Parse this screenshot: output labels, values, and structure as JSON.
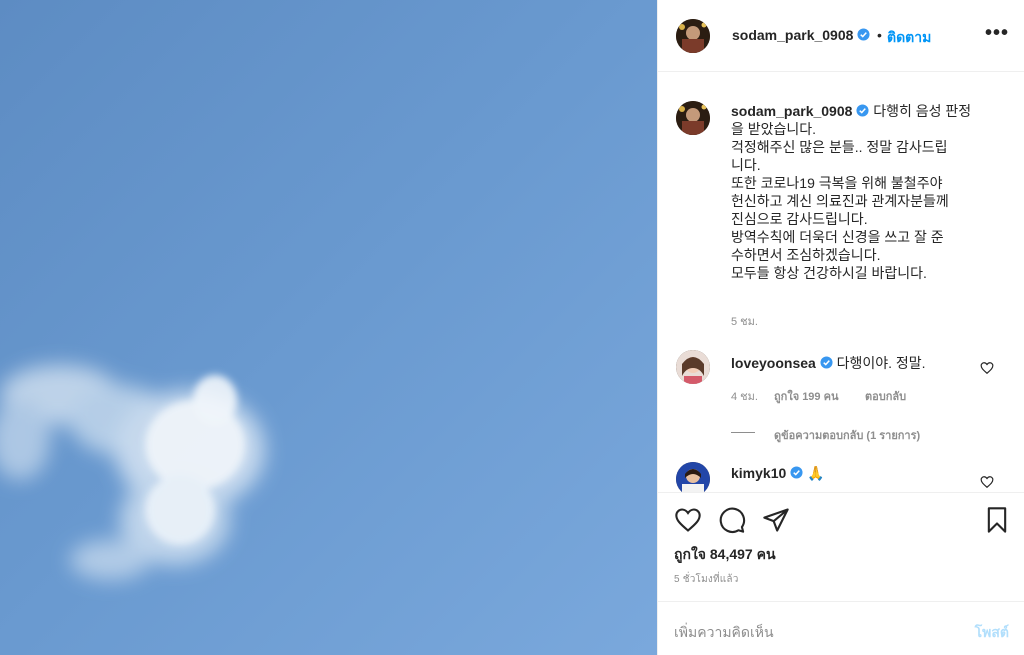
{
  "post": {
    "author": "sodam_park_0908",
    "follow_label": "ติดตาม",
    "separator": "•",
    "caption_lines": [
      "다행히 음성 판정",
      "을 받았습니다.",
      "걱정해주신 많은 분들.. 정말 감사드립",
      "니다.",
      "또한 코로나19 극복을 위해 불철주야",
      "헌신하고 계신 의료진과 관계자분들께",
      "진심으로 감사드립니다.",
      "방역수칙에 더욱더 신경을 쓰고 잘 준",
      "수하면서 조심하겠습니다.",
      "모두들 항상 건강하시길 바랍니다."
    ],
    "caption_time": "5 ชม.",
    "likes": "ถูกใจ 84,497 คน",
    "posted_time": "5 ชั่วโมงที่แล้ว",
    "comment_placeholder": "เพิ่มความคิดเห็น",
    "post_button": "โพสต์"
  },
  "comments": [
    {
      "username": "loveyoonsea",
      "text": "다행이야. 정말.",
      "time": "4 ชม.",
      "likes": "ถูกใจ 199 คน",
      "reply_label": "ตอบกลับ",
      "view_replies": "ดูข้อความตอบกลับ (1 รายการ)"
    },
    {
      "username": "kimyk10",
      "text": "🙏"
    }
  ],
  "icons": {
    "more": "more-options-icon",
    "verified": "verified-badge-icon",
    "like": "heart-icon",
    "comment": "comment-icon",
    "share": "paper-plane-icon",
    "save": "bookmark-icon"
  },
  "colors": {
    "accent": "#0095f6",
    "verified": "#3897f0",
    "muted": "#8e8e8e",
    "post_disabled": "#b2dffc",
    "sky": "#6b9bd0"
  }
}
